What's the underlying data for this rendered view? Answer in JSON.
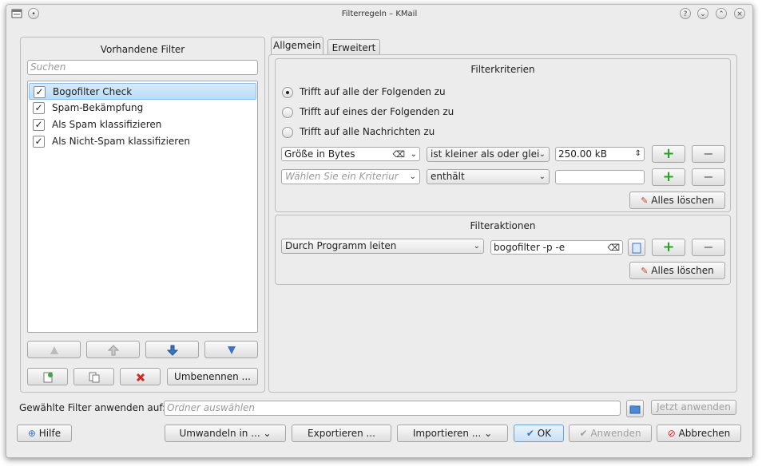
{
  "window": {
    "title": "Filterregeln – KMail"
  },
  "left": {
    "heading": "Vorhandene Filter",
    "search_placeholder": "Suchen",
    "filters": [
      {
        "label": "Bogofilter Check",
        "checked": true,
        "selected": true
      },
      {
        "label": "Spam-Bekämpfung",
        "checked": true,
        "selected": false
      },
      {
        "label": "Als Spam klassifizieren",
        "checked": true,
        "selected": false
      },
      {
        "label": "Als Nicht-Spam klassifizieren",
        "checked": true,
        "selected": false
      }
    ],
    "rename_label": "Umbenennen ..."
  },
  "tabs": [
    {
      "label": "Allgemein",
      "active": true
    },
    {
      "label": "Erweitert",
      "active": false
    }
  ],
  "criteria": {
    "heading": "Filterkriterien",
    "radio": [
      {
        "label": "Trifft auf alle der Folgenden zu",
        "checked": true
      },
      {
        "label": "Trifft auf eines der Folgenden zu",
        "checked": false
      },
      {
        "label": "Trifft auf alle Nachrichten zu",
        "checked": false
      }
    ],
    "rules": [
      {
        "field": "Größe in Bytes",
        "op": "ist kleiner als oder glei",
        "value": "250.00 kB"
      },
      {
        "field_placeholder": "Wählen Sie ein Kriteriur",
        "op": "enthält",
        "value": ""
      }
    ],
    "clear_label": "Alles löschen"
  },
  "actions": {
    "heading": "Filteraktionen",
    "action": "Durch Programm leiten",
    "value": "bogofilter -p -e",
    "clear_label": "Alles löschen"
  },
  "apply": {
    "label": "Gewählte Filter anwenden auf:",
    "placeholder": "Ordner auswählen",
    "button": "Jetzt anwenden"
  },
  "bottom": {
    "help": "Hilfe",
    "convert": "Umwandeln in ...",
    "export": "Exportieren ...",
    "import": "Importieren ...",
    "ok": "OK",
    "apply": "Anwenden",
    "cancel": "Abbrechen"
  }
}
